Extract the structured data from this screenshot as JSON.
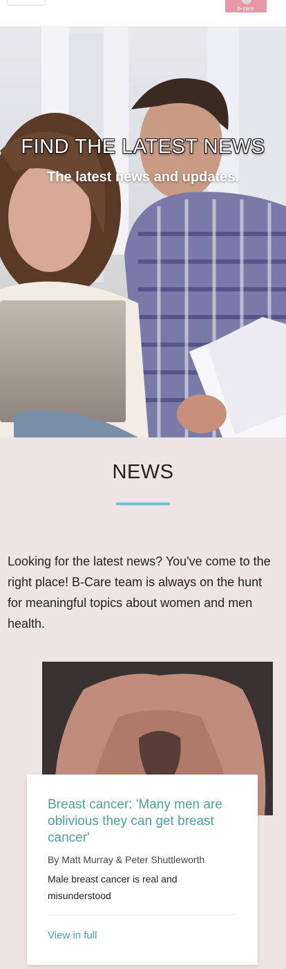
{
  "brand": {
    "logo_text": "b-care",
    "logo_color": "#e79aa6"
  },
  "hero": {
    "title": "FIND THE LATEST NEWS",
    "subtitle": "The latest news and updates."
  },
  "news": {
    "heading": "NEWS",
    "accent_color": "#6fc6d2",
    "intro": "Looking for the latest news? You've come to the right place! B-Care team is always on the hunt for meaningful topics about women and men health."
  },
  "articles": [
    {
      "title": "Breast cancer: 'Many men are oblivious they can get breast cancer'",
      "byline": "By Matt Murray & Peter Shuttleworth",
      "summary": "Male breast cancer is real and misunderstood",
      "link_label": "View in full",
      "accent_color": "#4ea0a3"
    }
  ]
}
